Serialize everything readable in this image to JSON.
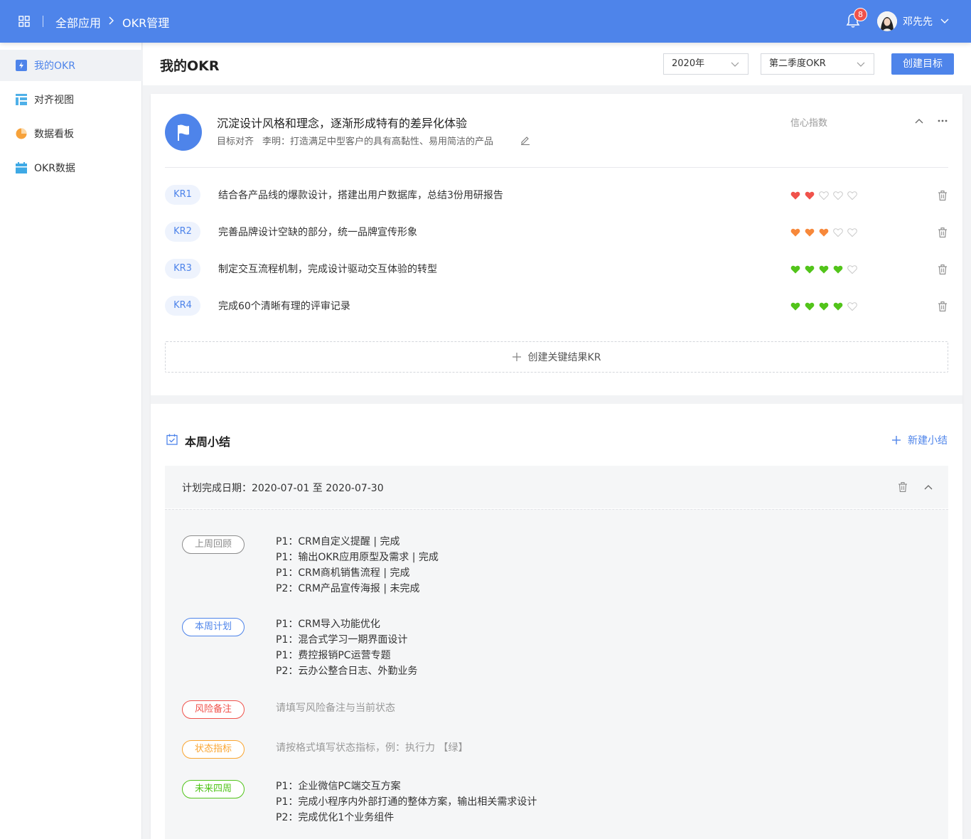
{
  "header": {
    "crumb_all_apps": "全部应用",
    "crumb_current": "OKR管理",
    "notification_count": "8",
    "username": "邓先先"
  },
  "sidebar": {
    "items": [
      {
        "label": "我的OKR",
        "icon": "okr-icon",
        "active": true
      },
      {
        "label": "对齐视图",
        "icon": "align-view-icon"
      },
      {
        "label": "数据看板",
        "icon": "pie-chart-icon"
      },
      {
        "label": "OKR数据",
        "icon": "calendar-icon"
      }
    ]
  },
  "page": {
    "title": "我的OKR",
    "year_select": "2020年",
    "quarter_select": "第二季度OKR",
    "create_button": "创建目标"
  },
  "objective": {
    "title": "沉淀设计风格和理念，逐渐形成特有的差异化体验",
    "align_label": "目标对齐",
    "align_value": "李明：打造满足中型客户的具有高黏性、易用简洁的产品",
    "confidence_label": "信心指数"
  },
  "key_results": [
    {
      "tag": "KR1",
      "text": "结合各产品线的爆款设计，搭建出用户数据库，总结3份用研报告",
      "confidence": 2,
      "color": "#f0524b"
    },
    {
      "tag": "KR2",
      "text": "完善品牌设计空缺的部分，统一品牌宣传形象",
      "confidence": 3,
      "color": "#f7883a"
    },
    {
      "tag": "KR3",
      "text": "制定交互流程机制，完成设计驱动交互体验的转型",
      "confidence": 4,
      "color": "#52c41a"
    },
    {
      "tag": "KR4",
      "text": "完成60个清晰有理的评审记录",
      "confidence": 4,
      "color": "#52c41a"
    }
  ],
  "create_kr_label": "创建关键结果KR",
  "weekly": {
    "title": "本周小结",
    "new_button": "新建小结",
    "date_label": "计划完成日期：2020-07-01 至 2020-07-30",
    "sections": {
      "last_week": {
        "tag": "上周回顾",
        "color": "#8c8c8c",
        "lines": [
          "P1：CRM自定义提醒 | 完成",
          "P1：输出OKR应用原型及需求 | 完成",
          "P1：CRM商机销售流程 | 完成",
          "P2：CRM产品宣传海报 | 未完成"
        ]
      },
      "this_week": {
        "tag": "本周计划",
        "color": "#4e84ea",
        "lines": [
          "P1：CRM导入功能优化",
          "P1：混合式学习一期界面设计",
          "P1：费控报销PC运营专题",
          "P2：云办公整合日志、外勤业务"
        ]
      },
      "risk": {
        "tag": "风险备注",
        "color": "#f0524b",
        "placeholder": "请填写风险备注与当前状态"
      },
      "status": {
        "tag": "状态指标",
        "color": "#faa530",
        "placeholder": "请按格式填写状态指标，例：执行力 【绿】"
      },
      "future": {
        "tag": "未来四周",
        "color": "#52c41a",
        "lines": [
          "P1：企业微信PC端交互方案",
          "P1：完成小程序内外部打通的整体方案，输出相关需求设计",
          "P2：完成优化1个业务组件"
        ]
      }
    }
  }
}
